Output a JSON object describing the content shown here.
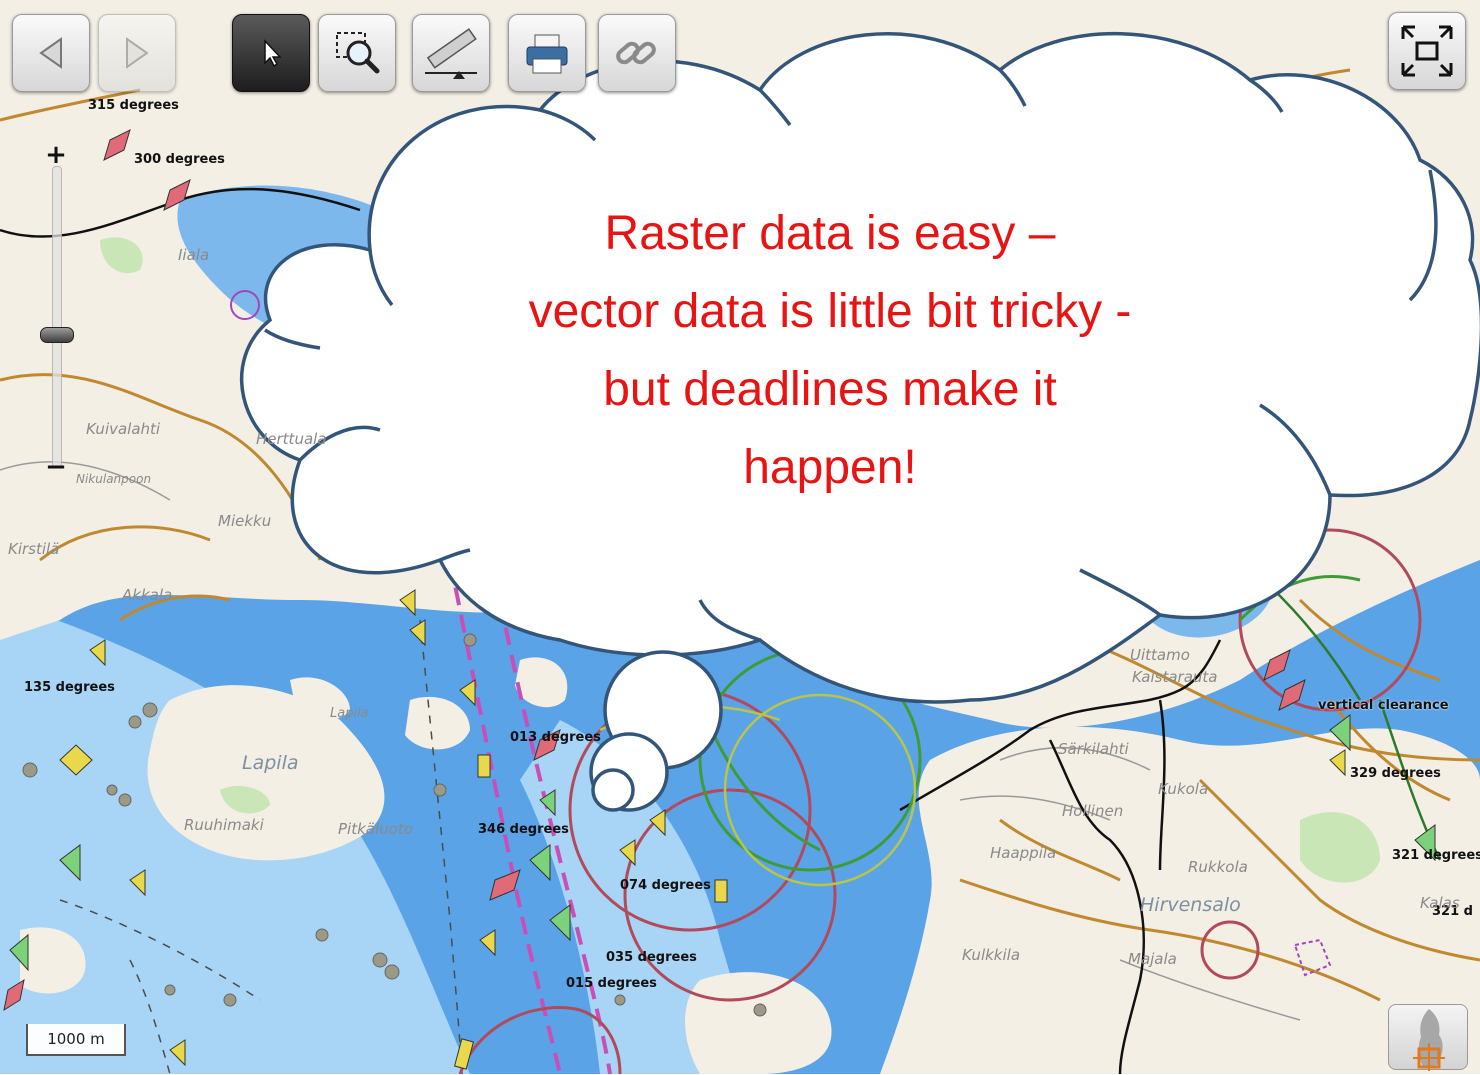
{
  "toolbar": {
    "buttons": [
      {
        "name": "back",
        "icon": "arrow-left-icon"
      },
      {
        "name": "forward",
        "icon": "arrow-right-icon"
      },
      {
        "name": "select",
        "icon": "cursor-arrow-icon",
        "active": true
      },
      {
        "name": "zoom-box",
        "icon": "zoom-box-icon"
      },
      {
        "name": "measure",
        "icon": "ruler-icon"
      },
      {
        "name": "print",
        "icon": "printer-icon"
      },
      {
        "name": "link",
        "icon": "chain-link-icon"
      }
    ],
    "fullscreen_icon": "fullscreen-icon"
  },
  "zoom": {
    "in_label": "+",
    "out_label": "−",
    "level_fraction": 0.56
  },
  "scale_bar": {
    "label": "1000 m"
  },
  "callout": {
    "lines": [
      "Raster data is easy –",
      "vector data is little bit tricky -",
      "but deadlines make it",
      "happen!"
    ]
  },
  "map_labels": {
    "degree_labels": [
      "315 degrees",
      "300 degrees",
      "135 degrees",
      "013 degrees",
      "346 degrees",
      "074 degrees",
      "035 degrees",
      "015 degrees",
      "329 degrees",
      "321 degrees",
      "321 d"
    ],
    "clearance_labels": [
      "vertical clearance"
    ],
    "place_names": [
      "Kuivalahti",
      "Nikulanpoon",
      "Miekku",
      "Kirstilä",
      "Akkala",
      "Lapila",
      "Lapila",
      "Ruuhimaki",
      "Pitkäluoto",
      "Kukola",
      "Rukkola",
      "Hirvensalo",
      "Kulkkila",
      "Majala",
      "Uittamo",
      "Särkilahti",
      "Haappila",
      "Hollinen",
      "Kaistarauta",
      "Kalas",
      "Iiala",
      "Herttuala"
    ]
  },
  "colors": {
    "sea": "#5aa3e6",
    "shallow": "#a8d4f5",
    "land": "#f3efe4",
    "road": "#c0892f",
    "fairway": "#c94fb8",
    "arc_red": "#b24a5c",
    "arc_green": "#3f9b36",
    "callout_text": "#e81313",
    "callout_outline": "#34557a"
  },
  "overview_icon": "finland-overview-map-icon"
}
